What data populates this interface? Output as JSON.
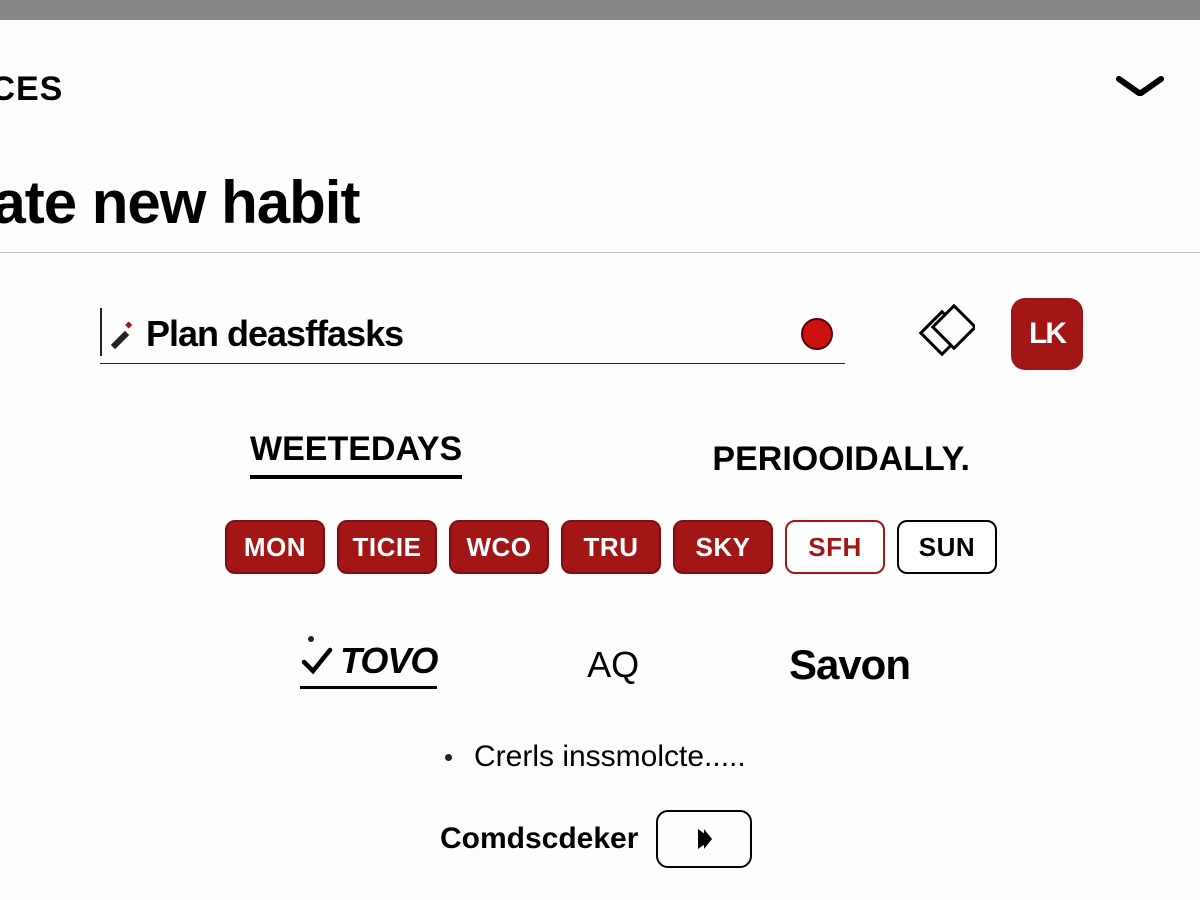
{
  "colors": {
    "accent": "#a31616"
  },
  "nav": {
    "label_partial": "ICES"
  },
  "header": {
    "title": "eate new habit"
  },
  "name": {
    "value": "Plan deasffasks",
    "color_marker": "#cc1111"
  },
  "actions": {
    "copy_icon": "copy",
    "confirm_label": "LK"
  },
  "tabs": {
    "weekdays": "WEETEDAYS",
    "periodically": "PERIOOIDALLY.",
    "active": "weekdays"
  },
  "days": [
    {
      "code": "MON",
      "selected": true
    },
    {
      "code": "TICIE",
      "selected": true
    },
    {
      "code": "WCO",
      "selected": true
    },
    {
      "code": "TRU",
      "selected": true
    },
    {
      "code": "SKY",
      "selected": true
    },
    {
      "code": "SFH",
      "selected": false,
      "red_outline": true
    },
    {
      "code": "SUN",
      "selected": false
    }
  ],
  "row2": {
    "todo": "TOVO",
    "search_glyph": "AQ",
    "save": "Savon"
  },
  "hint": "Crerls inssmolcte.....",
  "combo": {
    "label": "Comdscdeker"
  }
}
